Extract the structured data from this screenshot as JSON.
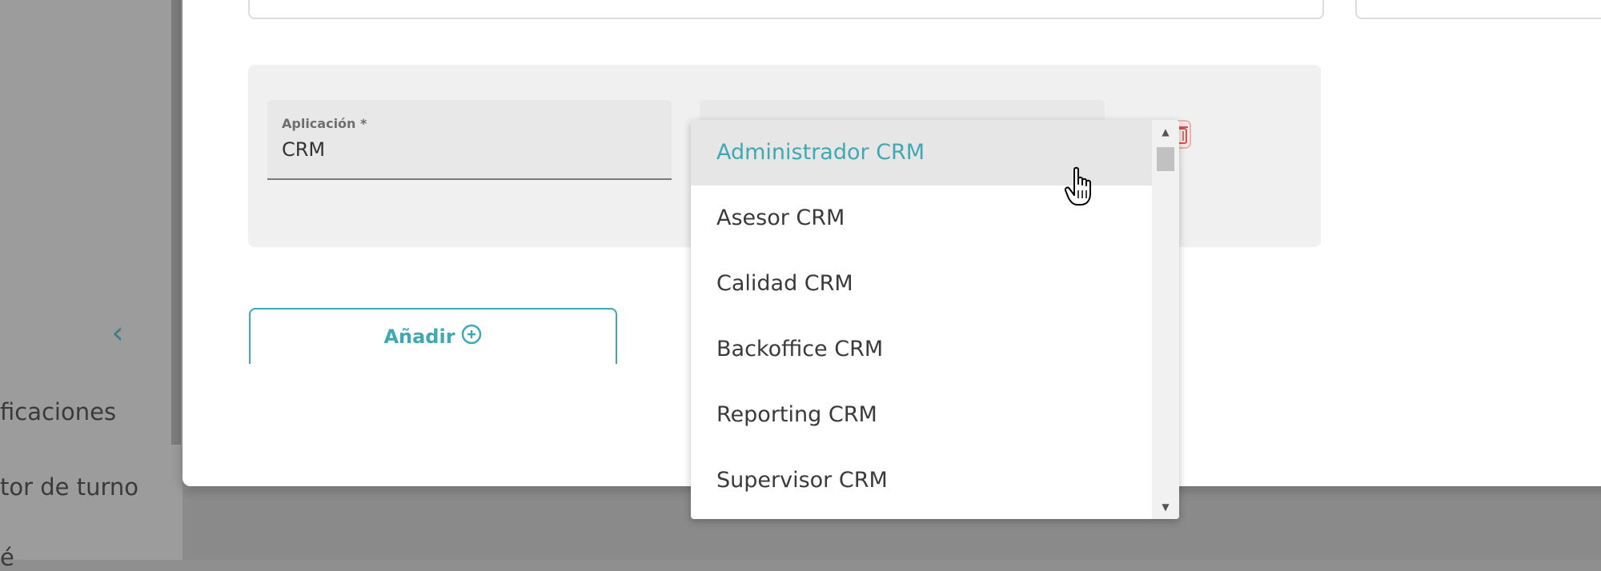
{
  "sidebar": {
    "items": [
      {
        "label": "ficaciones"
      },
      {
        "label": "tor de turno"
      },
      {
        "label": "é"
      }
    ]
  },
  "form": {
    "aplicacion": {
      "label": "Aplicación *",
      "value": "CRM"
    }
  },
  "actions": {
    "add_label": "Añadir"
  },
  "dropdown": {
    "options": [
      {
        "label": "Administrador CRM",
        "selected": true
      },
      {
        "label": "Asesor CRM"
      },
      {
        "label": "Calidad CRM"
      },
      {
        "label": "Backoffice CRM"
      },
      {
        "label": "Reporting CRM"
      },
      {
        "label": "Supervisor CRM"
      }
    ]
  },
  "colors": {
    "accent": "#3fa9b3",
    "delete": "#d9534f"
  },
  "icons": [
    "chevron-left-icon",
    "plus-circle-icon",
    "trash-icon",
    "hand-pointer-icon"
  ]
}
